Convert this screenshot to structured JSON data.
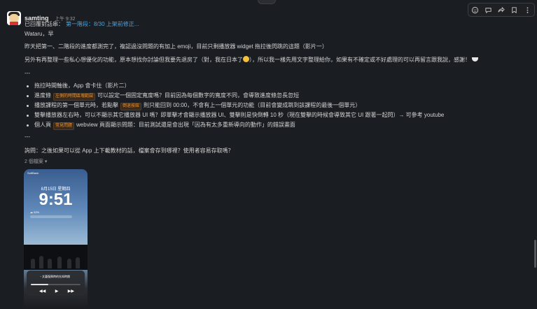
{
  "top_pill_label": "×",
  "message": {
    "sender": "samting",
    "time": "上午 9:32",
    "thread_prefix": "已回覆對話串：",
    "thread_link": "第一階段：8/30 上架前修正...",
    "greeting": "Wataru，早",
    "para1": "昨天把第一、二階段的進度都測完了，複認過沒問題的有加上 emoji，目前只剩播放器 widget 拖拉後閃跳的這題（影片一）",
    "para2_a": "另外有再整理一些私心想優化的功能，原本想找你討論但我要先退房了（對，我在日本了",
    "para2_b": "，所以我一樣先用文字整理給你，如果有不確定或不好處理的可以再留言跟我說，感謝！",
    "sep1": "---",
    "bullets": [
      {
        "before": "拖拉時間軸後，App 會卡住（影片二）",
        "tag": "",
        "after": ""
      },
      {
        "before": "進度條",
        "tag": "左側的時間區塊範圍",
        "after": "可以設定一個固定寬度嗎？目前因為每個數字的寬度不同，會導致進度條忽長忽短"
      },
      {
        "before": "播放課程的第一個單元時，若點擊",
        "tag": "倒退按鈕",
        "after": "則只能回到 00:00，不會有上一個單元的功能（目前會變成跳到該課程的最後一個單元）"
      },
      {
        "before": "雙擊播放器左右時，可以不顯示其它播放器 UI 嗎？即單擊才會顯示播放器 UI、雙擊則是快倒轉 10 秒（現在雙擊的時候會導致其它 UI 跟著一起閃）→ 可參考 youtube",
        "tag": "",
        "after": ""
      },
      {
        "before": "個人頁",
        "tag": "常見問題",
        "after": "webview 頁面顯示問題：目前測試還是會出現「因為有太多重新導向的動作」的錯誤畫面"
      }
    ],
    "sep2": "---",
    "question": "詢問：之後如果可以從 App 上下載教材的話，檔案會存到哪裡？使用者容易存取嗎？",
    "files_count": "2 個檔案",
    "files_caret": "▾"
  },
  "phone": {
    "carrier": "SoftBank",
    "date": "8月15日 星期四",
    "time": "9:51",
    "widget_text": "☁ 92%",
    "player_title": "・文藝復興時的先知時期",
    "progress": 0.35,
    "controls": [
      "◀◀",
      "▶",
      "▶▶"
    ]
  },
  "toolbar_icons": [
    "emoji-reaction-icon",
    "reply-thread-icon",
    "forward-icon",
    "bookmark-icon",
    "more-icon"
  ],
  "colors": {
    "link": "#4aa3e0",
    "tag": "#e8912d",
    "background": "#1a1d21"
  }
}
